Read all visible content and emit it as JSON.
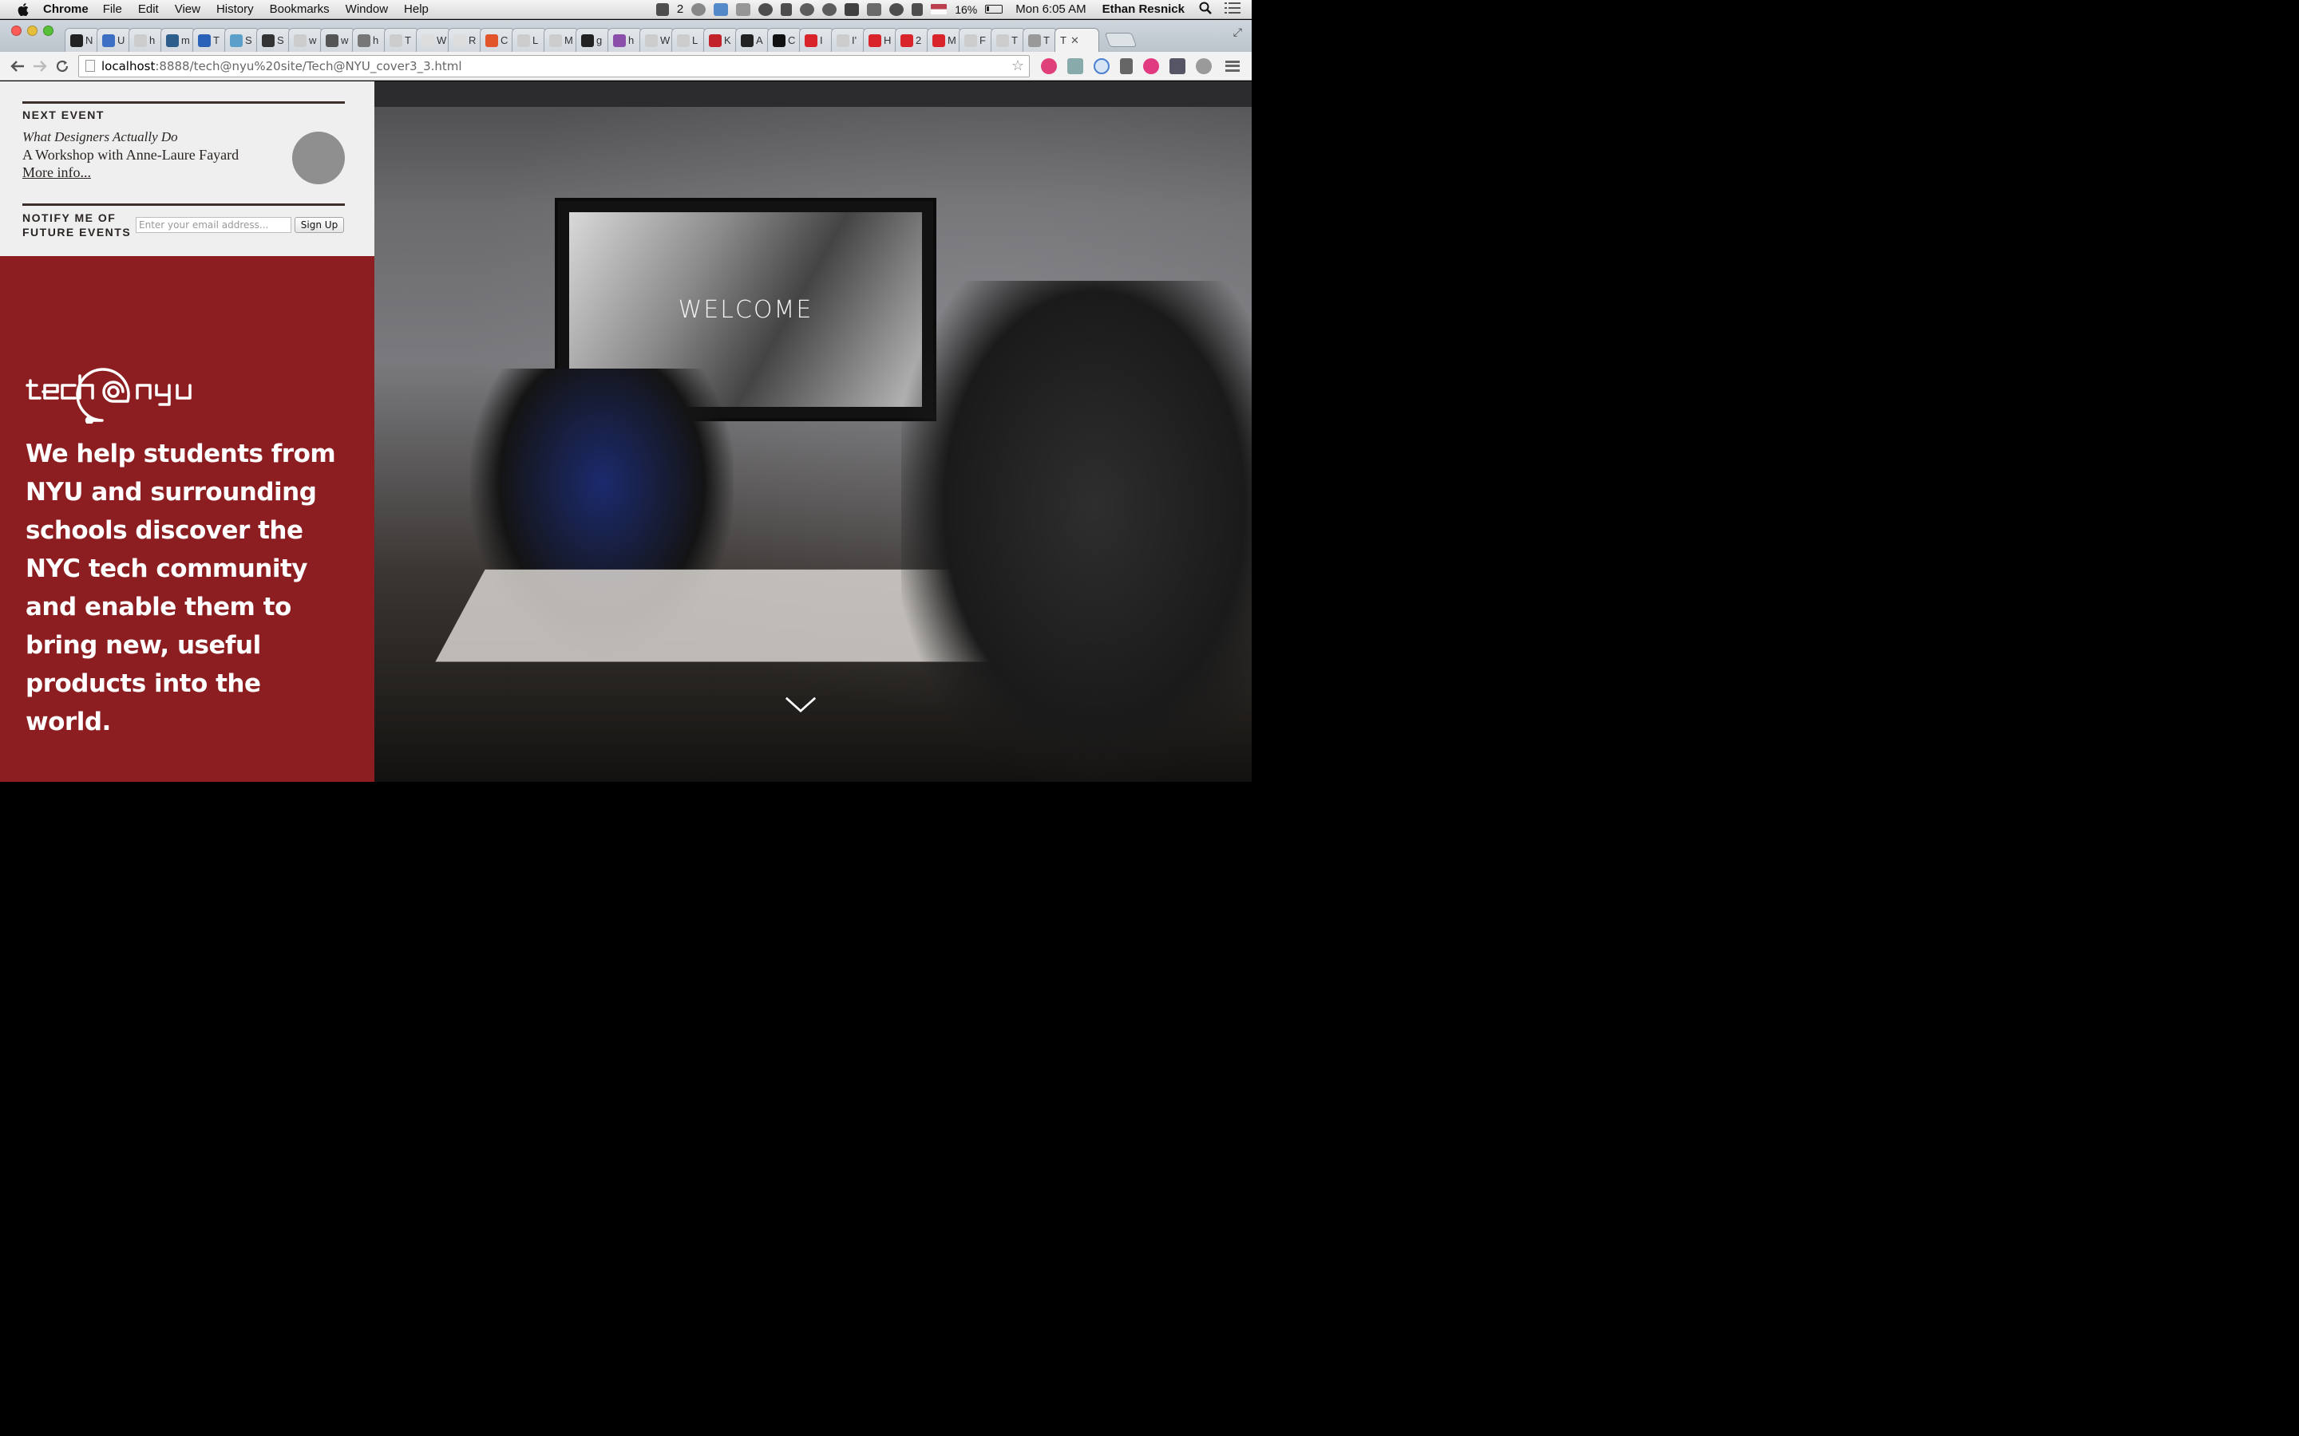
{
  "menubar": {
    "app_name": "Chrome",
    "menus": [
      "File",
      "Edit",
      "View",
      "History",
      "Bookmarks",
      "Window",
      "Help"
    ],
    "status_count": "2",
    "battery_percent": "16%",
    "clock": "Mon 6:05 AM",
    "user": "Ethan Resnick"
  },
  "tabs": [
    {
      "label": "N",
      "color": "#222222"
    },
    {
      "label": "U",
      "color": "#3b6fc4"
    },
    {
      "label": "h",
      "color": "#cccccc"
    },
    {
      "label": "m",
      "color": "#2d5d8a"
    },
    {
      "label": "T",
      "color": "#2a62b8"
    },
    {
      "label": "S",
      "color": "#5aa0c8"
    },
    {
      "label": "S",
      "color": "#333333"
    },
    {
      "label": "w",
      "color": "#cccccc"
    },
    {
      "label": "w",
      "color": "#555555"
    },
    {
      "label": "h",
      "color": "#777777"
    },
    {
      "label": "T",
      "color": "#cccccc"
    },
    {
      "label": "W",
      "color": "#dddddd"
    },
    {
      "label": "R",
      "color": "#dddddd"
    },
    {
      "label": "C",
      "color": "#e2552b"
    },
    {
      "label": "L",
      "color": "#cccccc"
    },
    {
      "label": "M",
      "color": "#cccccc"
    },
    {
      "label": "g",
      "color": "#222222"
    },
    {
      "label": "h",
      "color": "#8a4fa8"
    },
    {
      "label": "W",
      "color": "#cccccc"
    },
    {
      "label": "L",
      "color": "#cccccc"
    },
    {
      "label": "K",
      "color": "#c2222a"
    },
    {
      "label": "A",
      "color": "#222222"
    },
    {
      "label": "C",
      "color": "#111111"
    },
    {
      "label": "I",
      "color": "#d9242b"
    },
    {
      "label": "I'",
      "color": "#cccccc"
    },
    {
      "label": "H",
      "color": "#d9242b"
    },
    {
      "label": "2",
      "color": "#d9242b"
    },
    {
      "label": "M",
      "color": "#d9242b"
    },
    {
      "label": "F",
      "color": "#cccccc"
    },
    {
      "label": "T",
      "color": "#cccccc"
    },
    {
      "label": "T",
      "color": "#999999"
    }
  ],
  "active_tab": {
    "label": "T"
  },
  "address_bar": {
    "host": "localhost",
    "path": ":8888/tech@nyu%20site/Tech@NYU_cover3_3.html"
  },
  "sidebar": {
    "next_event_label": "NEXT EVENT",
    "event_title": "What Designers Actually Do",
    "event_subtitle": "A Workshop with Anne-Laure Fayard",
    "more_link": "More info...",
    "notify_label_line1": "NOTIFY ME OF",
    "notify_label_line2": "FUTURE EVENTS",
    "email_placeholder": "Enter your email address...",
    "signup_label": "Sign Up"
  },
  "hero": {
    "logo_text": "tech@nyu",
    "mission": "We help students from NYU and surrounding schools discover the NYC tech community and enable them to bring new, useful products into the world.",
    "screen_text": "WELCOME"
  },
  "colors": {
    "brand_red": "#8c1e22",
    "sidebar_bg": "#efefef",
    "rule": "#3a2f2a"
  }
}
